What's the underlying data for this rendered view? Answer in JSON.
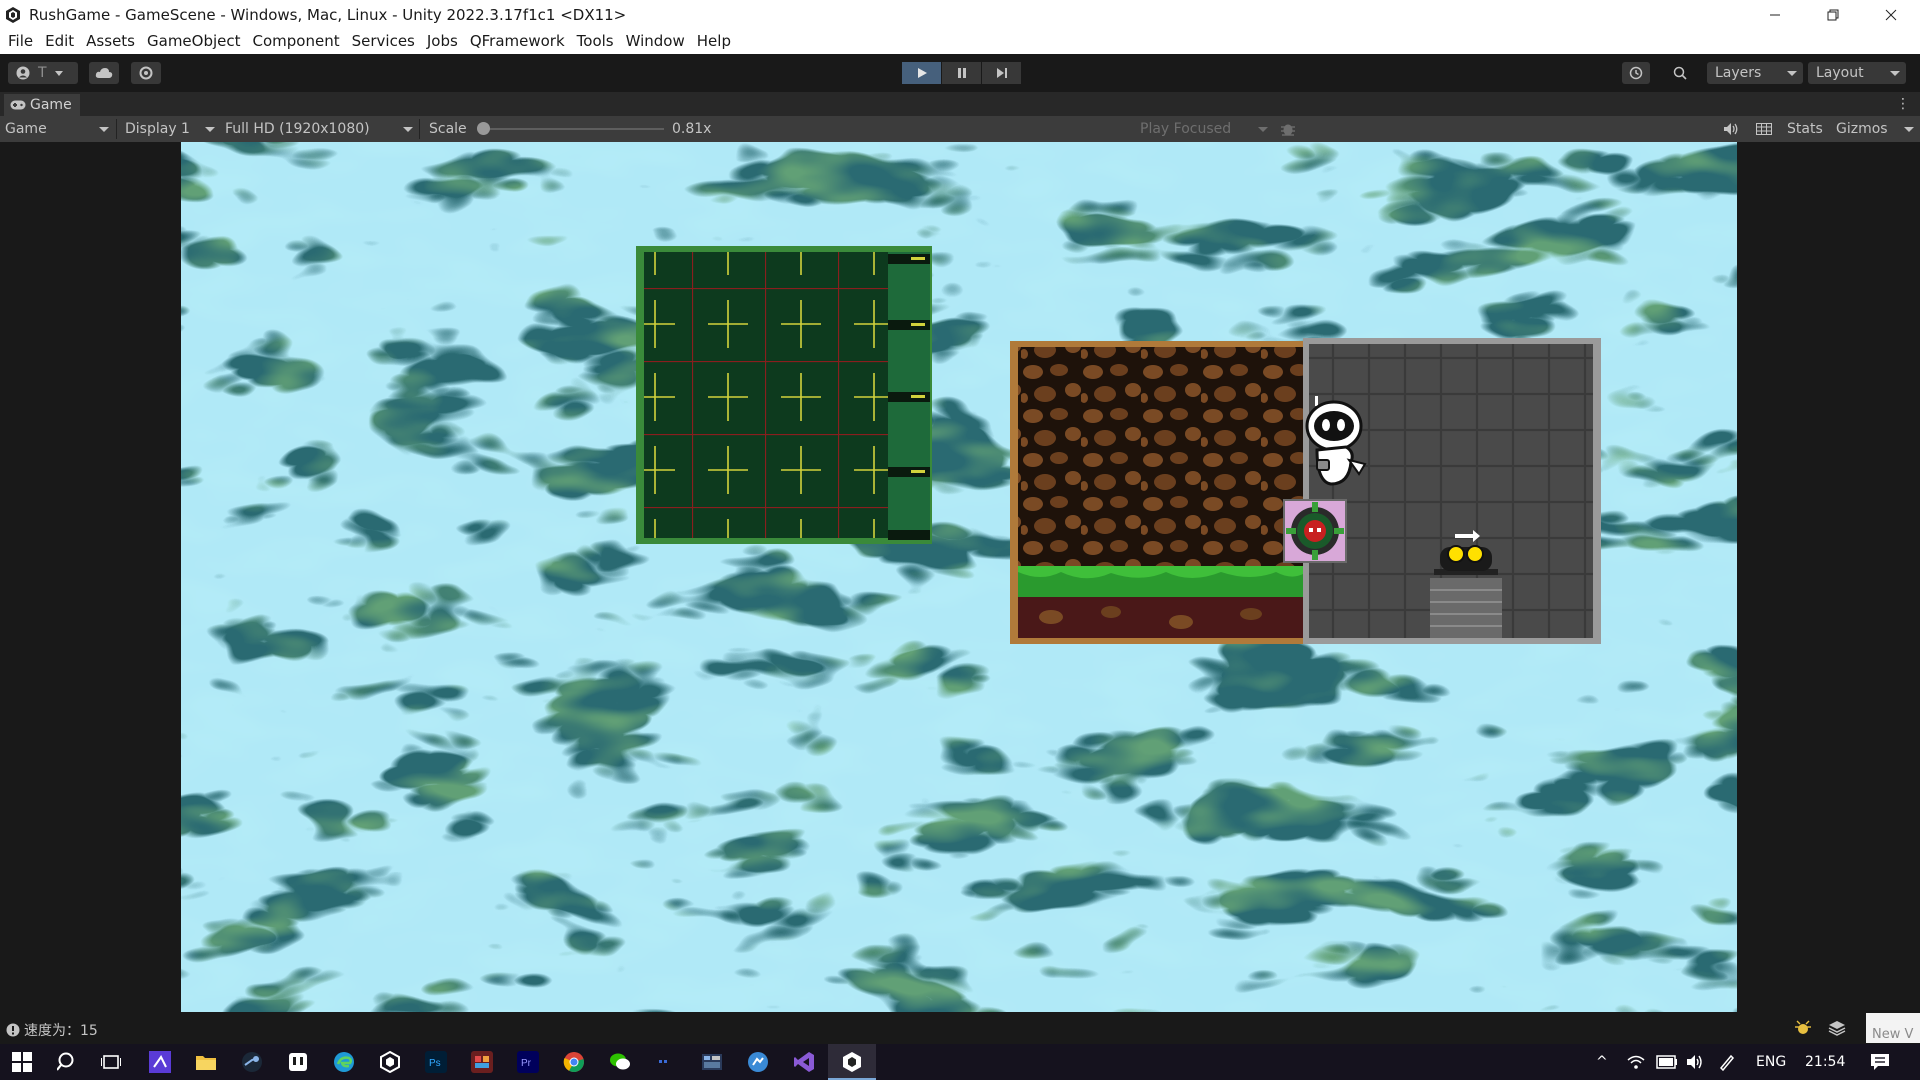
{
  "window": {
    "title": "RushGame - GameScene - Windows, Mac, Linux - Unity 2022.3.17f1c1 <DX11>"
  },
  "menu": [
    "File",
    "Edit",
    "Assets",
    "GameObject",
    "Component",
    "Services",
    "Jobs",
    "QFramework",
    "Tools",
    "Window",
    "Help"
  ],
  "toolbar": {
    "account_initial": "T",
    "layers_label": "Layers",
    "layout_label": "Layout"
  },
  "game_tab": {
    "label": "Game"
  },
  "game_bar": {
    "view_mode": "Game",
    "display": "Display 1",
    "resolution": "Full HD (1920x1080)",
    "scale_label": "Scale",
    "scale_value": "0.81x",
    "scale_fraction": 0.0,
    "play_mode": "Play Focused",
    "stats_label": "Stats",
    "gizmos_label": "Gizmos"
  },
  "status": {
    "message": "速度为：15",
    "new_popup": "New V"
  },
  "taskbar": {
    "language": "ENG",
    "time": "21:54",
    "app_icons": [
      "search-icon",
      "task-view-icon",
      "visual-studio-code-icon",
      "file-explorer-icon",
      "steam-icon",
      "notes-app-icon",
      "edge-icon",
      "unity-hub-icon",
      "photoshop-icon",
      "video-editor-icon",
      "premiere-icon",
      "chrome-icon",
      "wechat-icon",
      "app-icon",
      "aseprite-icon",
      "messenger-icon",
      "visual-studio-icon",
      "unity-icon"
    ]
  },
  "colors": {
    "unity_dark": "#191919",
    "panel": "#3c3c3c",
    "play_active": "#46607c",
    "circuit_green": "#0d3a1e",
    "rock_brown": "#2a1a0e",
    "grass_green": "#3fbf3a",
    "grid_gray": "#4a4a4a"
  }
}
